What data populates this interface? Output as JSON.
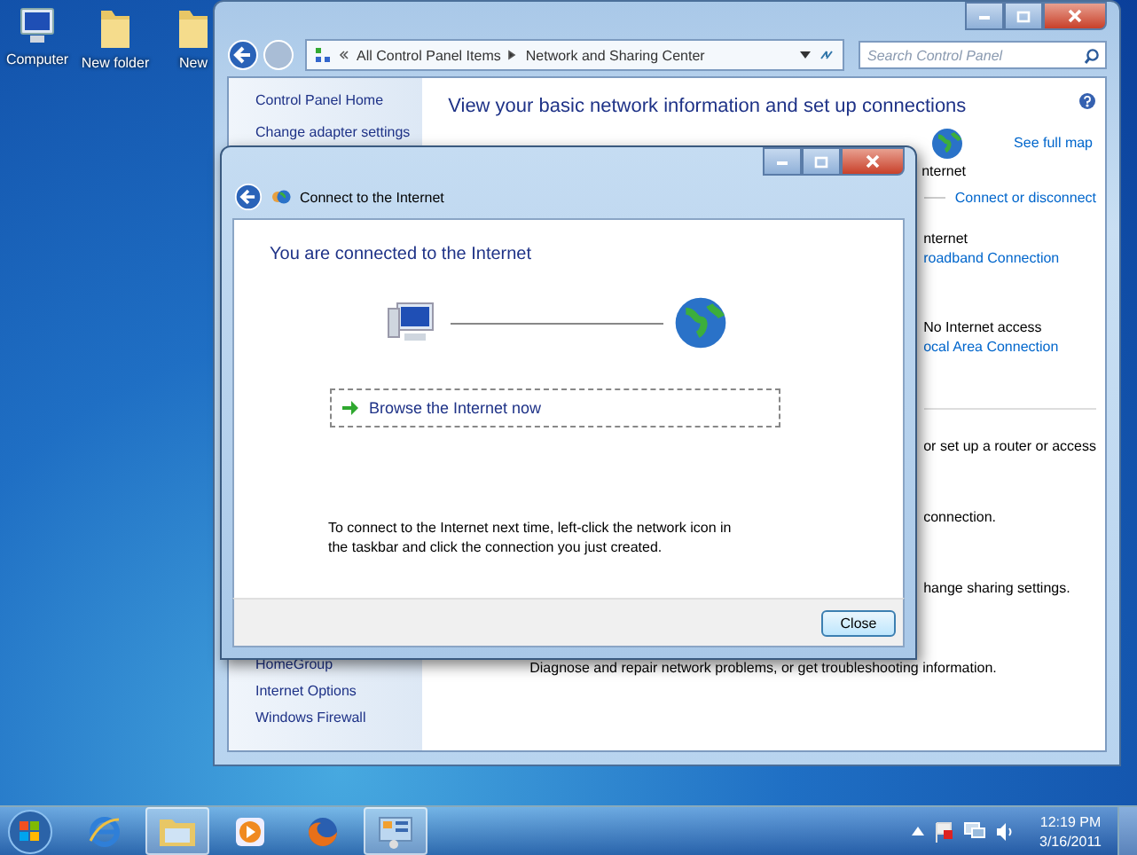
{
  "desktop_icons": [
    {
      "kind": "computer",
      "label": "Computer"
    },
    {
      "kind": "folder",
      "label": "New folder"
    },
    {
      "kind": "folder",
      "label": "New"
    }
  ],
  "control_panel": {
    "address": [
      "All Control Panel Items",
      "Network and Sharing Center"
    ],
    "search": {
      "placeholder": "Search Control Panel"
    },
    "sidebar_top": [
      "Control Panel Home",
      "Change adapter settings"
    ],
    "sidebar_bottom": [
      "HomeGroup",
      "Internet Options",
      "Windows Firewall"
    ],
    "heading": "View your basic network information and set up connections",
    "see_full_map": "See full map",
    "map_label": "nternet",
    "connect_link": "Connect or disconnect",
    "networks": [
      {
        "access": "nternet",
        "connection": "roadband Connection"
      },
      {
        "access": "No Internet access",
        "connection": "ocal Area Connection"
      }
    ],
    "tasks": [
      "or set up a router or access",
      "connection.",
      "hange sharing settings."
    ],
    "troubleshoot": "Diagnose and repair network problems, or get troubleshooting information."
  },
  "dialog": {
    "title": "Connect to the Internet",
    "heading": "You are connected to the Internet",
    "browse": "Browse the Internet now",
    "note": "To connect to the Internet next time, left-click the network icon in the taskbar and click the connection you just created.",
    "close": "Close"
  },
  "taskbar": {
    "apps": [
      {
        "kind": "ie",
        "open": false
      },
      {
        "kind": "explorer",
        "open": true
      },
      {
        "kind": "media",
        "open": false
      },
      {
        "kind": "firefox",
        "open": false
      },
      {
        "kind": "control-panel",
        "open": true
      }
    ],
    "clock": {
      "time": "12:19 PM",
      "date": "3/16/2011"
    }
  }
}
